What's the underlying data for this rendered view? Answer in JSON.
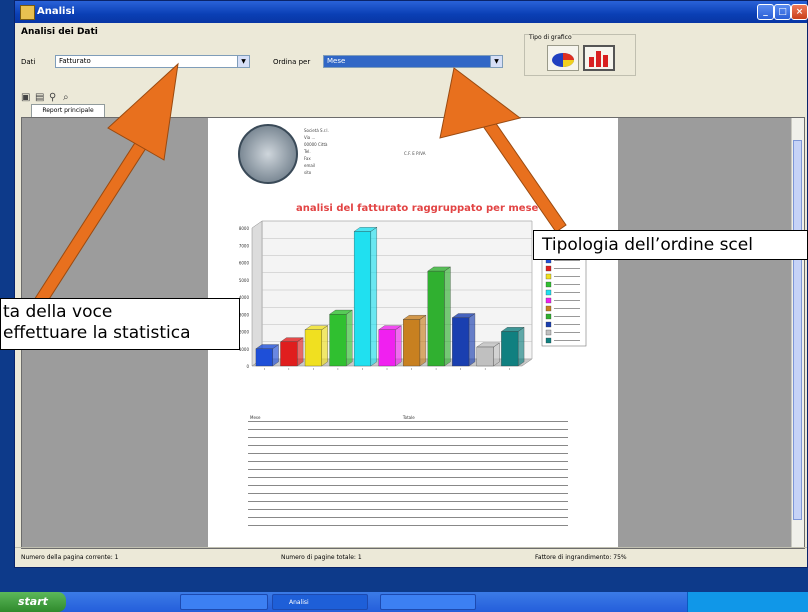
{
  "window": {
    "title": "Analisi",
    "header": "Analisi dei Dati",
    "controls": {
      "minimize": "_",
      "maximize": "□",
      "close": "×"
    }
  },
  "filters": {
    "left_label": "Dati",
    "left_value": "Fatturato",
    "right_label": "Ordina per",
    "right_value": "Mese",
    "chart_type_group": "Tipo di grafico"
  },
  "toolbar": {
    "icons": [
      "print-icon",
      "export-icon",
      "find-icon",
      "zoom-icon"
    ]
  },
  "tab": "Report principale",
  "report": {
    "title": "analisi del fatturato raggruppato per mese",
    "address_lines": [
      "Società S.r.l.",
      "Via ...",
      "00000 Città",
      "Tel.",
      "Fax",
      "email",
      "sito"
    ],
    "vat_text": "C.F. E P.IVA",
    "table_header": [
      "Mese",
      "Totale"
    ],
    "table_rows": [
      [
        "",
        ""
      ],
      [
        "",
        ""
      ],
      [
        "",
        ""
      ],
      [
        "",
        ""
      ],
      [
        "",
        ""
      ],
      [
        "",
        ""
      ],
      [
        "",
        ""
      ],
      [
        "",
        ""
      ],
      [
        "",
        ""
      ],
      [
        "",
        ""
      ],
      [
        "",
        ""
      ],
      [
        "",
        ""
      ],
      [
        "",
        ""
      ]
    ]
  },
  "status": {
    "current_page": "Numero della pagina corrente: 1",
    "total_pages": "Numero di pagine totale: 1",
    "zoom": "Fattore di ingrandimento: 75%"
  },
  "taskbar": {
    "start_label": "start",
    "tasks": [
      "",
      "Analisi",
      ""
    ],
    "clock": ""
  },
  "callouts": {
    "left_line1": "ta della voce",
    "left_line2": "effettuare la statistica",
    "right": "Tipologia dell’ordine scel"
  },
  "colors": {
    "arrow": "#e8701e",
    "title_red": "#e24444",
    "bars": [
      "#1e4fd8",
      "#e01e1e",
      "#f0e020",
      "#30c030",
      "#20e0f0",
      "#f020f0",
      "#c88020",
      "#30b030",
      "#1a3fb0",
      "#c0c0c0",
      "#108080"
    ]
  },
  "chart_data": {
    "type": "bar",
    "title": "analisi del fatturato raggruppato per mese",
    "values": [
      1000,
      1400,
      2100,
      3000,
      7800,
      2100,
      2700,
      5500,
      2800,
      1100,
      2000
    ],
    "ylim": [
      0,
      8000
    ],
    "yticks": [
      0,
      1000,
      2000,
      3000,
      4000,
      5000,
      6000,
      7000,
      8000
    ],
    "legend": "right",
    "grid": true
  }
}
